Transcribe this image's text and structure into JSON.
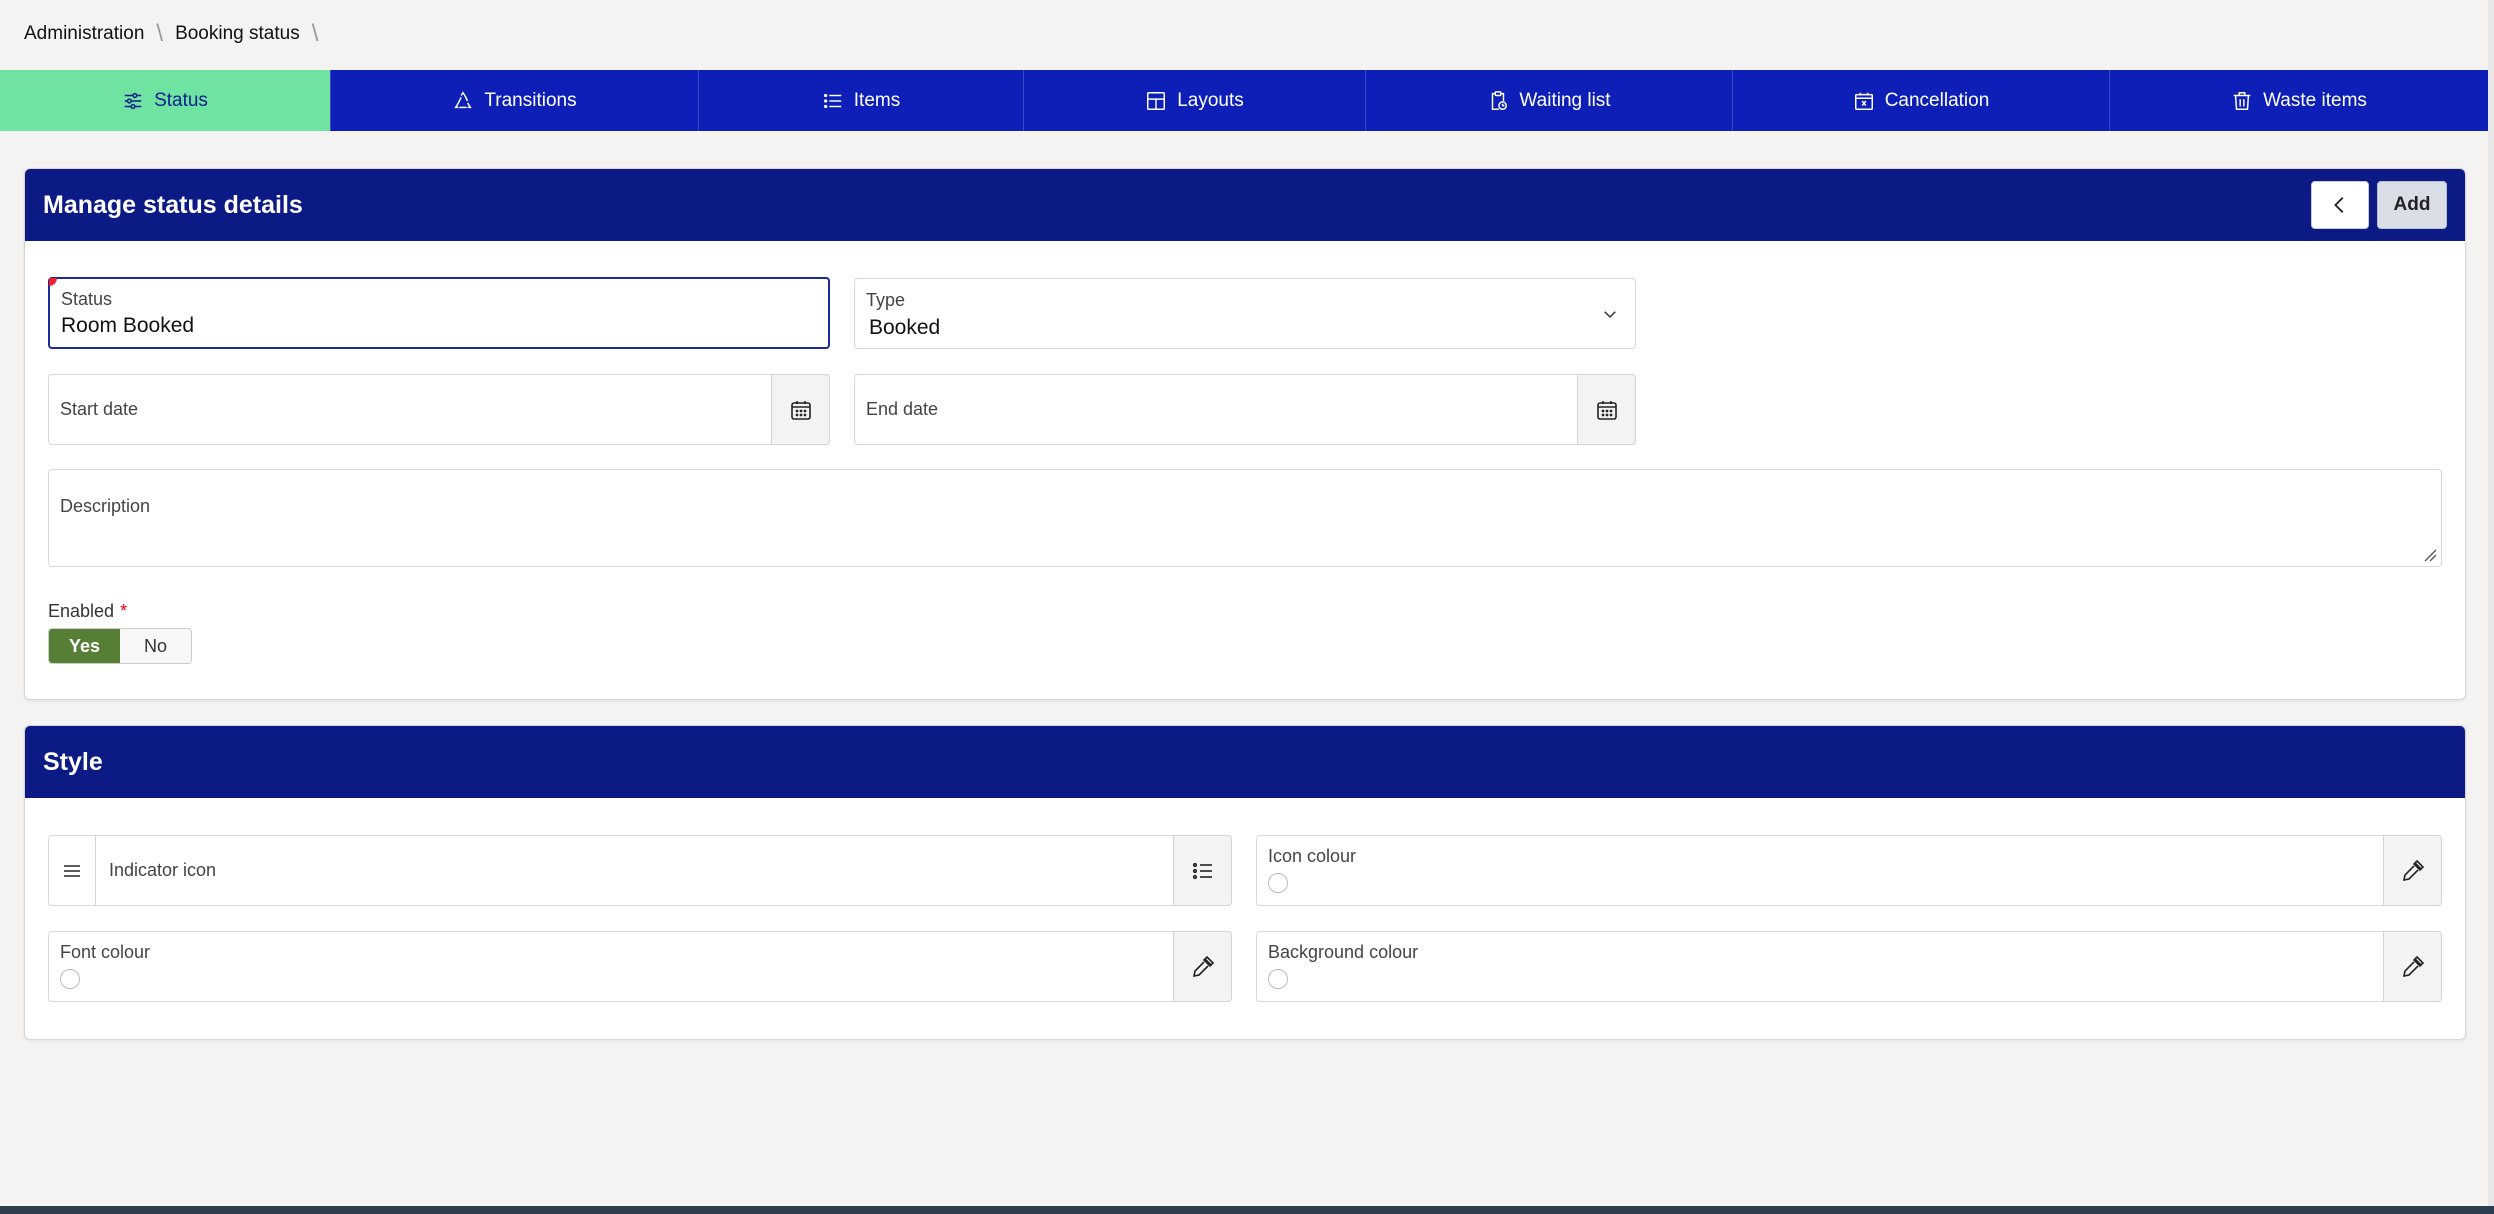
{
  "breadcrumb": {
    "items": [
      "Administration",
      "Booking status"
    ]
  },
  "tabs": [
    {
      "label": "Status",
      "icon": "sliders-icon",
      "active": true
    },
    {
      "label": "Transitions",
      "icon": "recycle-icon"
    },
    {
      "label": "Items",
      "icon": "list-icon"
    },
    {
      "label": "Layouts",
      "icon": "layout-icon"
    },
    {
      "label": "Waiting list",
      "icon": "clipboard-clock-icon"
    },
    {
      "label": "Cancellation",
      "icon": "calendar-x-icon"
    },
    {
      "label": "Waste items",
      "icon": "trash-icon"
    }
  ],
  "status_card": {
    "title": "Manage status details",
    "add_label": "Add",
    "status_field": {
      "label": "Status",
      "value": "Room Booked"
    },
    "type_field": {
      "label": "Type",
      "value": "Booked"
    },
    "start_date": {
      "label": "Start date"
    },
    "end_date": {
      "label": "End date"
    },
    "description": {
      "label": "Description"
    },
    "enabled": {
      "label": "Enabled",
      "required_mark": "*",
      "yes": "Yes",
      "no": "No",
      "selected": "Yes"
    }
  },
  "style_card": {
    "title": "Style",
    "indicator_icon": {
      "label": "Indicator icon"
    },
    "icon_colour": {
      "label": "Icon colour"
    },
    "font_colour": {
      "label": "Font colour"
    },
    "background_colour": {
      "label": "Background colour"
    }
  },
  "colors": {
    "tab_bar": "#0d1fb6",
    "tab_active": "#6ee3a2",
    "card_header": "#0c1a85",
    "toggle_yes": "#567f35"
  }
}
